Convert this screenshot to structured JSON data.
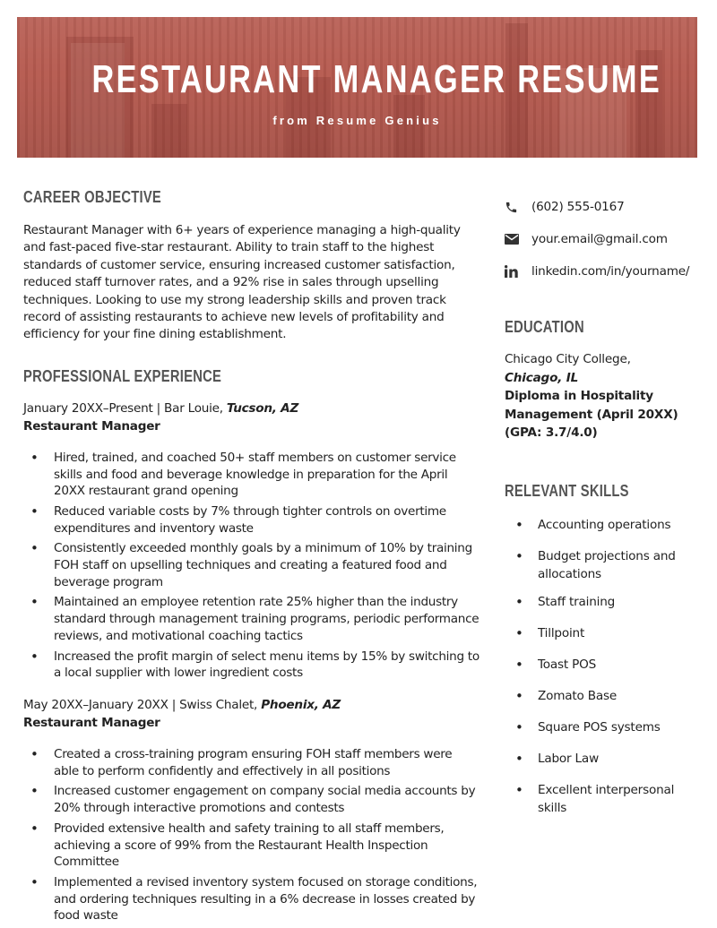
{
  "banner": {
    "title": "RESTAURANT MANAGER RESUME",
    "subtitle": "from Resume Genius",
    "color": "#b65a4f"
  },
  "objective": {
    "heading": "CAREER OBJECTIVE",
    "text": "Restaurant Manager with 6+ years of experience managing a high-quality and fast-paced five-star restaurant. Ability to train staff to the highest standards of customer service, ensuring increased customer satisfaction, reduced staff turnover rates, and a 92% rise in sales through upselling techniques. Looking to use my strong leadership skills and proven track record of assisting restaurants to achieve new levels of profitability and efficiency for your fine dining establishment."
  },
  "experience": {
    "heading": "PROFESSIONAL EXPERIENCE",
    "jobs": [
      {
        "dates_company": "January 20XX–Present | Bar Louie, ",
        "location": "Tucson, AZ",
        "title": "Restaurant Manager",
        "bullets": [
          "Hired, trained, and coached 50+ staff members on customer service skills and food and beverage knowledge in preparation for the April 20XX restaurant grand opening",
          "Reduced variable costs by 7% through tighter controls on overtime expenditures and inventory waste",
          "Consistently exceeded monthly goals by a minimum of 10% by training FOH staff on upselling techniques and creating a featured food and beverage program",
          "Maintained an employee retention rate 25% higher than the industry standard through management training programs, periodic performance reviews, and motivational coaching tactics",
          "Increased the profit margin of select menu items by 15% by switching to a local supplier with lower ingredient costs"
        ]
      },
      {
        "dates_company": "May 20XX–January 20XX | Swiss Chalet, ",
        "location": "Phoenix, AZ",
        "title": "Restaurant Manager",
        "bullets": [
          "Created a cross-training program ensuring FOH staff members were able to perform confidently and effectively in all positions",
          "Increased customer engagement on company social media accounts by 20% through interactive promotions and contests",
          "Provided extensive health and safety training to all staff members, achieving a score of 99% from the Restaurant Health Inspection Committee",
          "Implemented a revised inventory system focused on storage conditions, and ordering techniques resulting in a 6% decrease in losses created by food waste"
        ]
      }
    ]
  },
  "contact": {
    "phone": "(602) 555-0167",
    "email": "your.email@gmail.com",
    "linkedin": "linkedin.com/in/yourname/",
    "icons": [
      "phone-icon",
      "email-icon",
      "linkedin-icon"
    ]
  },
  "education": {
    "heading": "EDUCATION",
    "school": "Chicago City College,",
    "location": "Chicago, IL",
    "degree_line1": "Diploma in Hospitality",
    "degree_line2": "Management (April 20XX)",
    "gpa": "(GPA: 3.7/4.0)"
  },
  "skills": {
    "heading": "RELEVANT SKILLS",
    "items": [
      "Accounting operations",
      "Budget projections and allocations",
      "Staff training",
      "Tillpoint",
      "Toast POS",
      "Zomato Base",
      "Square POS systems",
      "Labor Law",
      "Excellent interpersonal skills"
    ]
  }
}
